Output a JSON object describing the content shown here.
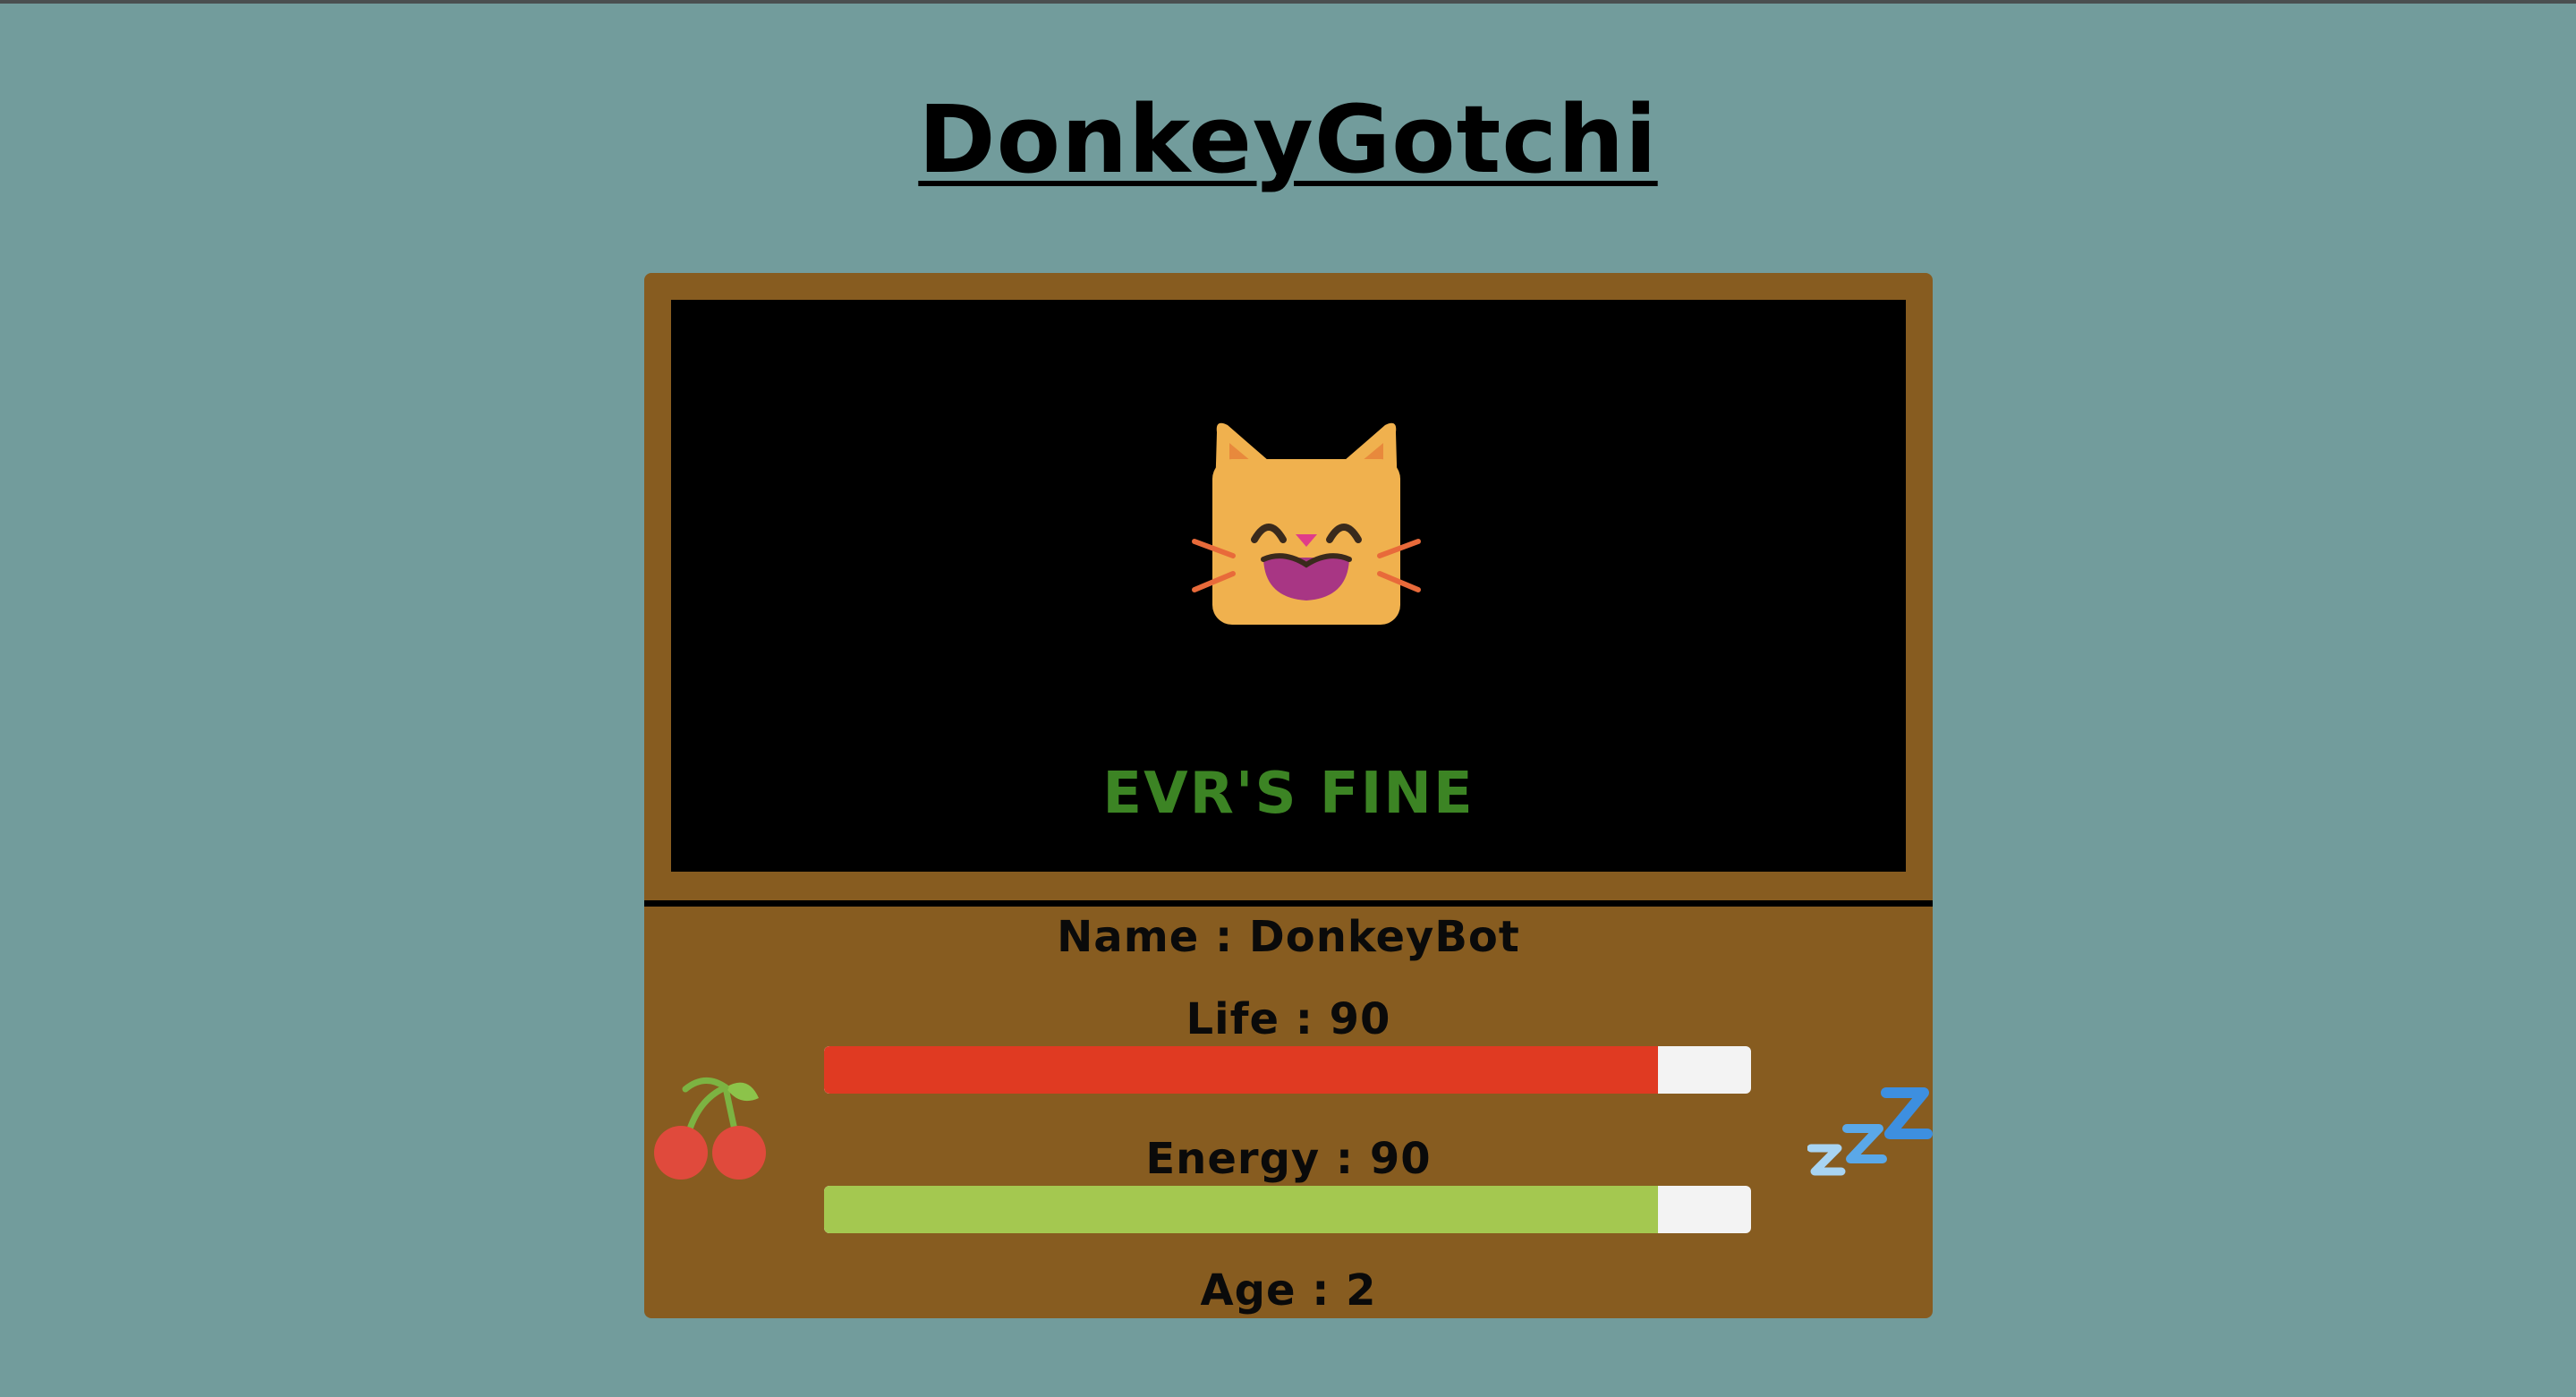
{
  "app": {
    "title": "DonkeyGotchi"
  },
  "screen": {
    "pet_icon": "smiling-cat-face-icon",
    "status_text": "EVR'S FINE",
    "status_color": "#3c8424"
  },
  "stats": {
    "name_label": "Name : DonkeyBot",
    "life_label": "Life : 90",
    "life_value": 90,
    "life_max": 100,
    "life_color": "#e03a22",
    "energy_label": "Energy : 90",
    "energy_value": 90,
    "energy_max": 100,
    "energy_color": "#a4c850",
    "age_label": "Age : 2"
  },
  "actions": {
    "feed_icon": "cherries-icon",
    "sleep_icon": "zzz-icon"
  },
  "colors": {
    "background": "#729c9c",
    "device": "#875c20",
    "screen": "#000000"
  }
}
